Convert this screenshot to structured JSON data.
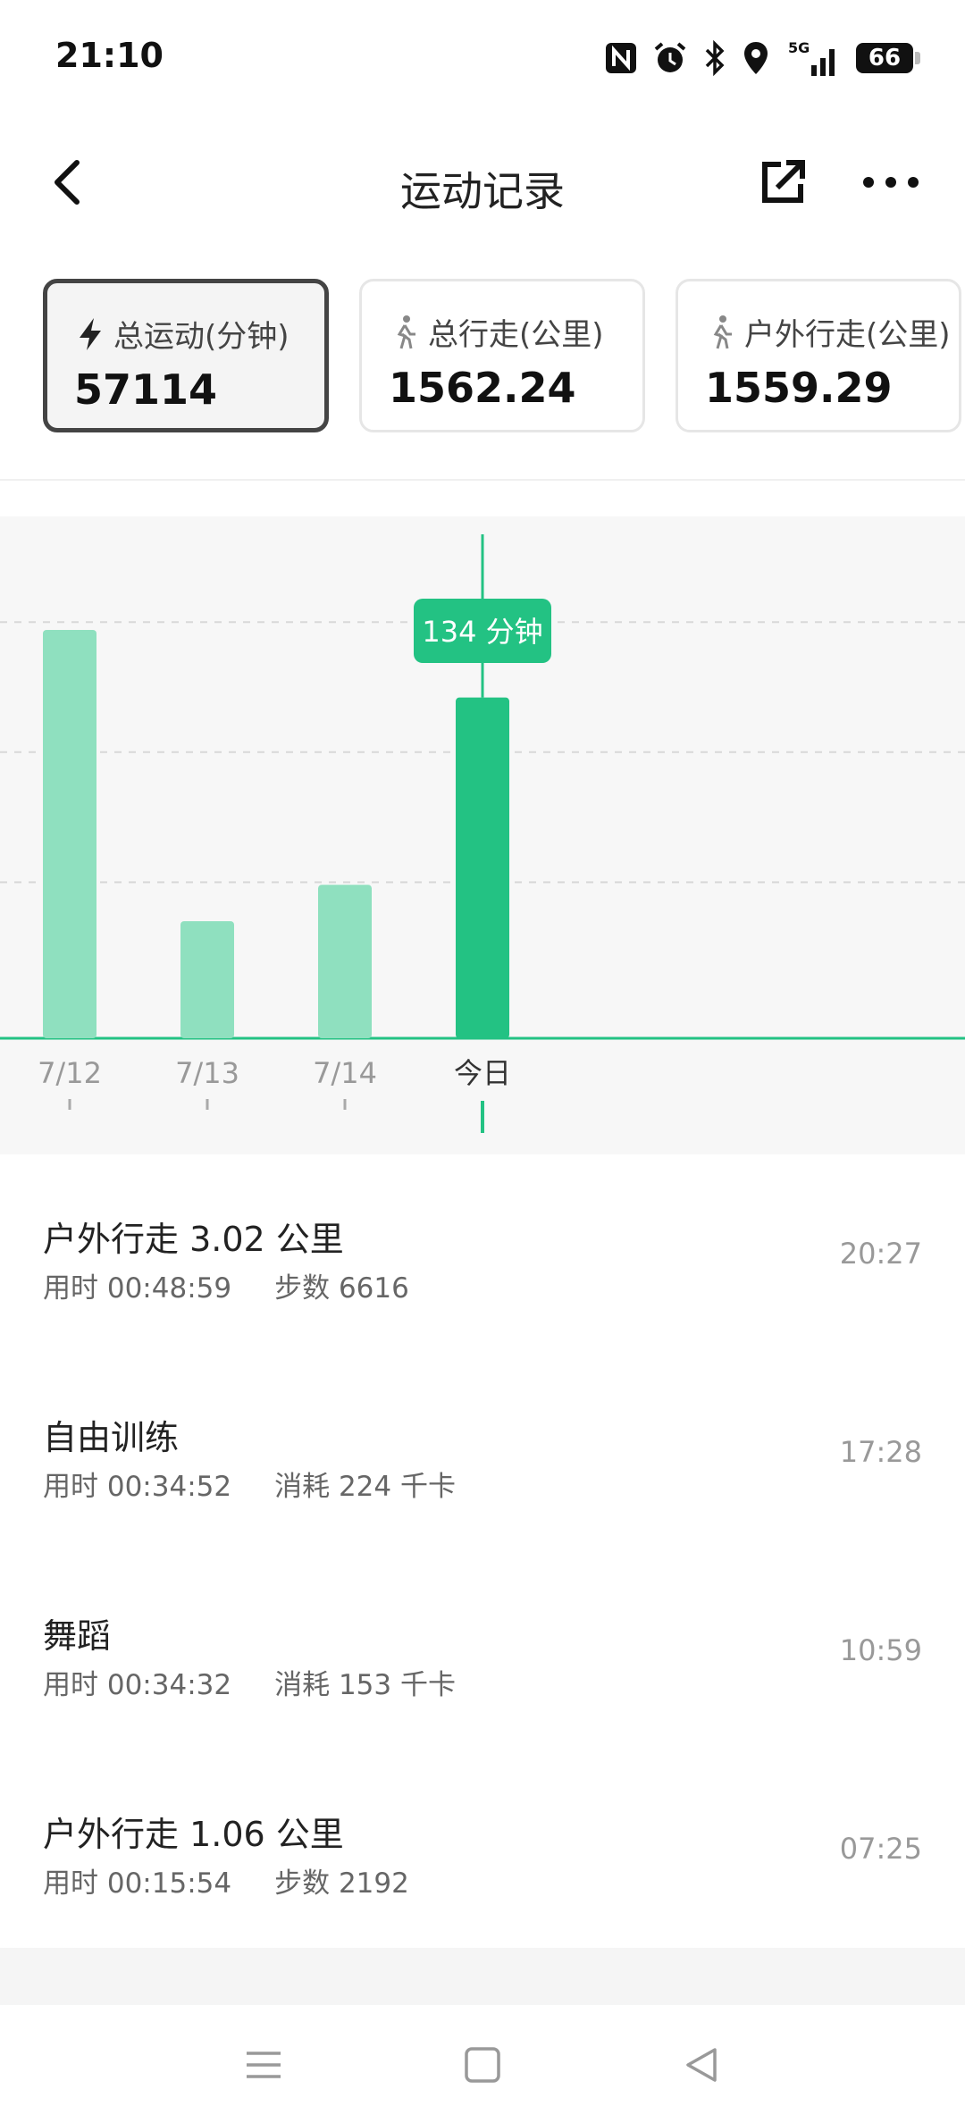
{
  "status": {
    "time": "21:10",
    "battery": "66",
    "icons": [
      "nfc-icon",
      "alarm-icon",
      "bluetooth-icon",
      "location-icon",
      "signal-5g-icon",
      "battery-icon"
    ]
  },
  "header": {
    "title": "运动记录",
    "back_icon": "back-arrow-icon",
    "share_icon": "share-icon",
    "more_icon": "more-icon"
  },
  "summary_tabs": [
    {
      "label": "总运动(分钟)",
      "value": "57114",
      "icon": "lightning-icon",
      "active": true
    },
    {
      "label": "总行走(公里)",
      "value": "1562.24",
      "icon": "walk-icon",
      "active": false
    },
    {
      "label": "户外行走(公里)",
      "value": "1559.29",
      "icon": "walk-icon",
      "active": false
    }
  ],
  "chart_data": {
    "type": "bar",
    "categories": [
      "7/12",
      "7/13",
      "7/14",
      "今日"
    ],
    "values": [
      157,
      45,
      59,
      131
    ],
    "tooltip": "134 分钟",
    "selected_index": 3,
    "ylim": [
      0,
      180
    ],
    "gridlines": [
      60,
      110,
      160
    ],
    "colors": {
      "bar": "#8fe0bf",
      "selected": "#23c283"
    }
  },
  "records": [
    {
      "title": "户外行走 3.02 公里",
      "duration": "用时 00:48:59",
      "metric": "步数 6616",
      "time": "20:27"
    },
    {
      "title": "自由训练",
      "duration": "用时 00:34:52",
      "metric": "消耗 224 千卡",
      "time": "17:28"
    },
    {
      "title": "舞蹈",
      "duration": "用时 00:34:32",
      "metric": "消耗 153 千卡",
      "time": "10:59"
    },
    {
      "title": "户外行走 1.06 公里",
      "duration": "用时 00:15:54",
      "metric": "步数 2192",
      "time": "07:25"
    }
  ],
  "navbar": {
    "icons": [
      "menu-icon",
      "home-icon",
      "back-triangle-icon"
    ]
  }
}
